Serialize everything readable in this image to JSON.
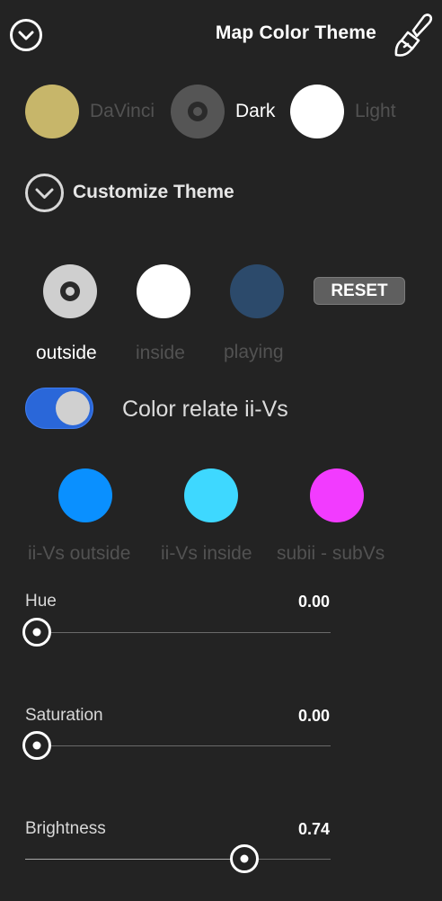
{
  "header": {
    "title": "Map Color Theme",
    "collapse_icon": "chevron-down-circle-icon",
    "brush_icon": "paint-brush-icon"
  },
  "themes": [
    {
      "label": "DaVinci",
      "color": "#c7b66a",
      "selected": false
    },
    {
      "label": "Dark",
      "color": "#555555",
      "selected": true
    },
    {
      "label": "Light",
      "color": "#ffffff",
      "selected": false
    }
  ],
  "customize": {
    "label": "Customize Theme",
    "icon": "chevron-down-circle-icon"
  },
  "color_slots": [
    {
      "label": "outside",
      "color": "#cfcfcf",
      "selected": true
    },
    {
      "label": "inside",
      "color": "#ffffff",
      "selected": false
    },
    {
      "label": "playing",
      "color": "#2c4a6b",
      "selected": false
    }
  ],
  "reset_label": "RESET",
  "toggle": {
    "label": "Color relate ii-Vs",
    "on": true,
    "color": "#2a67d9"
  },
  "iiv_colors": [
    {
      "label": "ii-Vs outside",
      "color": "#0a90ff"
    },
    {
      "label": "ii-Vs inside",
      "color": "#3ed8ff"
    },
    {
      "label": "subii - subVs",
      "color": "#f23bff"
    }
  ],
  "sliders": [
    {
      "label": "Hue",
      "value": "0.00",
      "level": 0.0
    },
    {
      "label": "Saturation",
      "value": "0.00",
      "level": 0.0
    },
    {
      "label": "Brightness",
      "value": "0.74",
      "level": 0.74
    }
  ]
}
